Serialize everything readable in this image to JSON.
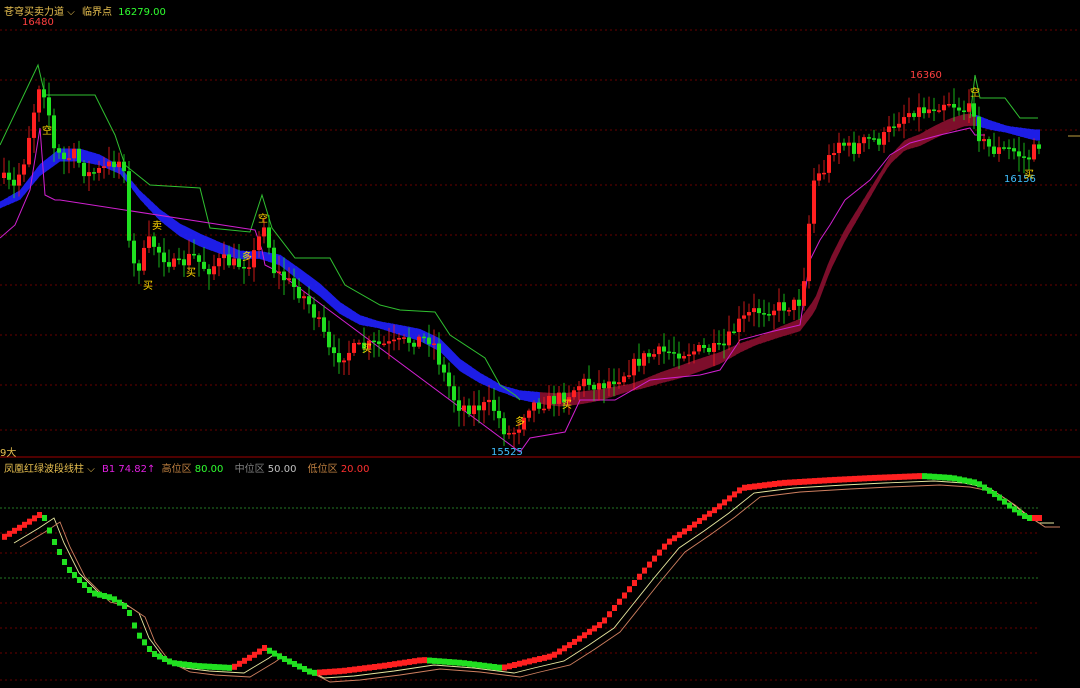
{
  "upper_header": {
    "indicator_name": "苍穹买卖力道",
    "dropdown_glyph": "⌵",
    "key_label": "临界点",
    "key_value": "16279.00"
  },
  "lower_header": {
    "indicator_name": "凤凰红绿波段线柱",
    "dropdown_glyph": "⌵",
    "b1_label": "B1",
    "b1_value": "74.82↑",
    "high_label": "高位区",
    "high_value": "80.00",
    "mid_label": "中位区",
    "mid_value": "50.00",
    "low_label": "低位区",
    "low_value": "20.00"
  },
  "edge_label": "9大",
  "colors": {
    "up": "#ff2020",
    "down": "#20e020",
    "band_down": "#2020ff",
    "band_up": "#8b1030",
    "upper_envelope": "#30c030",
    "lower_envelope": "#d020d0",
    "signal": "#ffd700",
    "grid_red": "#8b0000",
    "hi_annot": "#ff4040",
    "lo_annot": "#40c0ff",
    "zone_high": "#ff2020",
    "zone_mid": "#808080",
    "zone_low": "#ff2020",
    "b1": "#e020e0"
  },
  "chart_data": [
    {
      "type": "candlestick",
      "series": [
        {
          "name": "临界点",
          "last": 16279.0
        }
      ],
      "annotations": [
        {
          "text": "16480",
          "x": 6,
          "y": 16480,
          "color": "red"
        },
        {
          "text": "16360",
          "x": 162,
          "y": 16360,
          "color": "red"
        },
        {
          "text": "15525",
          "x": 85,
          "y": 15525,
          "color": "cyan"
        },
        {
          "text": "16156",
          "x": 171,
          "y": 16156,
          "color": "cyan"
        }
      ],
      "signals": [
        {
          "text": "空",
          "x": 7
        },
        {
          "text": "买",
          "x": 23
        },
        {
          "text": "买",
          "x": 30
        },
        {
          "text": "卖",
          "x": 25
        },
        {
          "text": "多",
          "x": 40
        },
        {
          "text": "空",
          "x": 43
        },
        {
          "text": "买",
          "x": 60
        },
        {
          "text": "多",
          "x": 85
        },
        {
          "text": "买",
          "x": 93
        },
        {
          "text": "空",
          "x": 161
        },
        {
          "text": "买",
          "x": 170
        }
      ]
    },
    {
      "type": "bar",
      "series": [
        {
          "name": "B1",
          "last": 74.82
        }
      ],
      "levels": [
        {
          "name": "高位区",
          "value": 80.0
        },
        {
          "name": "中位区",
          "value": 50.0
        },
        {
          "name": "低位区",
          "value": 20.0
        }
      ]
    }
  ]
}
